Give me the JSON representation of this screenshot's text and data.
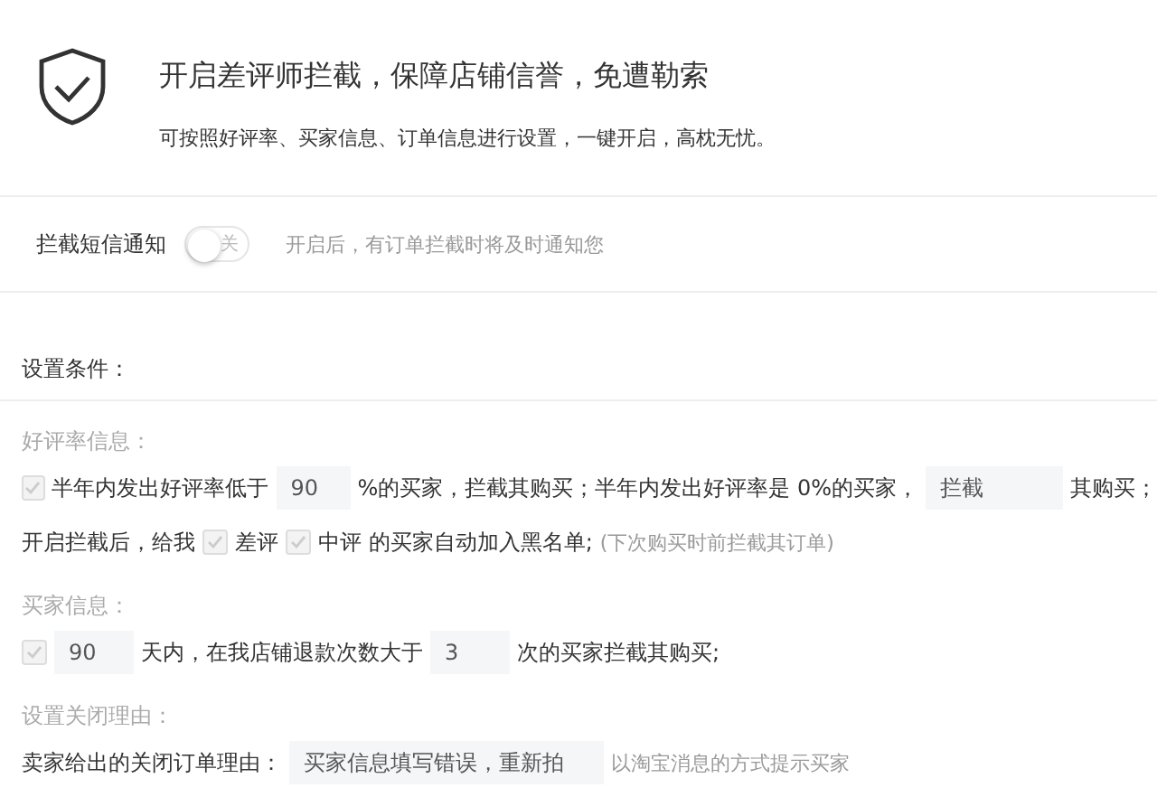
{
  "header": {
    "title": "开启差评师拦截，保障店铺信誉，免遭勒索",
    "subtitle": "可按照好评率、买家信息、订单信息进行设置，一键开启，高枕无忧。"
  },
  "sms": {
    "label": "拦截短信通知",
    "switch": {
      "on": false,
      "label": "关"
    },
    "hint": "开启后，有订单拦截时将及时通知您"
  },
  "conditions": {
    "heading": "设置条件：",
    "sections": [
      {
        "title": "好评率信息：",
        "lines": [
          {
            "parts": [
              {
                "kind": "checkbox",
                "checked": true,
                "disabled": true
              },
              {
                "kind": "text",
                "text": "半年内发出好评率低于"
              },
              {
                "kind": "input",
                "value": "90"
              },
              {
                "kind": "text",
                "text": "%的买家，拦截其购买；半年内发出好评率是 0%的买家，"
              },
              {
                "kind": "select",
                "value": "拦截"
              },
              {
                "kind": "text",
                "text": "其购买；"
              }
            ]
          },
          {
            "parts": [
              {
                "kind": "text",
                "text": "开启拦截后，给我"
              },
              {
                "kind": "checkbox",
                "checked": true,
                "disabled": true
              },
              {
                "kind": "text",
                "text": "差评"
              },
              {
                "kind": "checkbox",
                "checked": true,
                "disabled": true
              },
              {
                "kind": "text",
                "text": "中评 的买家自动加入黑名单;"
              },
              {
                "kind": "hint",
                "text": "(下次购买时前拦截其订单)"
              }
            ]
          }
        ]
      },
      {
        "title": "买家信息：",
        "lines": [
          {
            "parts": [
              {
                "kind": "checkbox",
                "checked": true,
                "disabled": true
              },
              {
                "kind": "input",
                "value": "90"
              },
              {
                "kind": "text",
                "text": "天内，在我店铺退款次数大于"
              },
              {
                "kind": "input",
                "value": "3"
              },
              {
                "kind": "text",
                "text": "次的买家拦截其购买;"
              }
            ]
          }
        ]
      },
      {
        "title": "设置关闭理由：",
        "lines": [
          {
            "parts": [
              {
                "kind": "text",
                "text": "卖家给出的关闭订单理由："
              },
              {
                "kind": "select",
                "value": "买家信息填写错误，重新拍"
              },
              {
                "kind": "hint",
                "text": "以淘宝消息的方式提示买家"
              }
            ]
          }
        ]
      }
    ]
  }
}
